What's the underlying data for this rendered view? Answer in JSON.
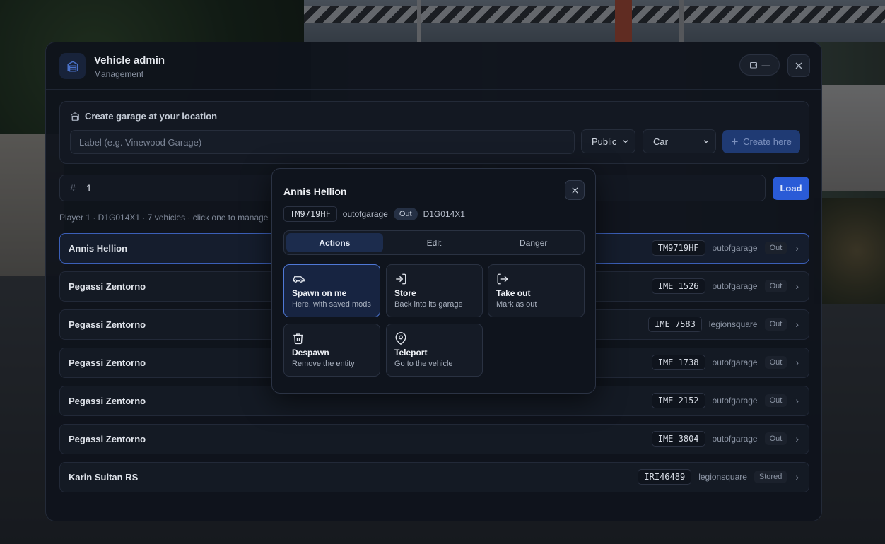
{
  "window": {
    "title": "Vehicle admin",
    "subtitle": "Management",
    "minimize_label": "—"
  },
  "garage_form": {
    "title": "Create garage at your location",
    "label_placeholder": "Label (e.g. Vinewood Garage)",
    "visibility": "Public",
    "type": "Car",
    "create_label": "Create here"
  },
  "search": {
    "prefix": "#",
    "value": "1",
    "load_label": "Load"
  },
  "player_line": "Player 1 · D1G014X1 · 7 vehicles · click one to manage it",
  "vehicles": [
    {
      "name": "Annis Hellion",
      "plate": "TM9719HF",
      "garage": "outofgarage",
      "status": "Out"
    },
    {
      "name": "Pegassi Zentorno",
      "plate": "IME 1526",
      "garage": "outofgarage",
      "status": "Out"
    },
    {
      "name": "Pegassi Zentorno",
      "plate": "IME 7583",
      "garage": "legionsquare",
      "status": "Out"
    },
    {
      "name": "Pegassi Zentorno",
      "plate": "IME 1738",
      "garage": "outofgarage",
      "status": "Out"
    },
    {
      "name": "Pegassi Zentorno",
      "plate": "IME 2152",
      "garage": "outofgarage",
      "status": "Out"
    },
    {
      "name": "Pegassi Zentorno",
      "plate": "IME 3804",
      "garage": "outofgarage",
      "status": "Out"
    },
    {
      "name": "Karin Sultan RS",
      "plate": "IRI46489",
      "garage": "legionsquare",
      "status": "Stored"
    }
  ],
  "modal": {
    "title": "Annis Hellion",
    "plate": "TM9719HF",
    "garage": "outofgarage",
    "status": "Out",
    "owner": "D1G014X1",
    "tabs": [
      "Actions",
      "Edit",
      "Danger"
    ],
    "active_tab": "Actions",
    "actions": [
      {
        "icon": "car-icon",
        "title": "Spawn on me",
        "subtitle": "Here, with saved mods"
      },
      {
        "icon": "log-in-icon",
        "title": "Store",
        "subtitle": "Back into its garage"
      },
      {
        "icon": "log-out-icon",
        "title": "Take out",
        "subtitle": "Mark as out"
      },
      {
        "icon": "trash-icon",
        "title": "Despawn",
        "subtitle": "Remove the entity"
      },
      {
        "icon": "map-pin-icon",
        "title": "Teleport",
        "subtitle": "Go to the vehicle"
      }
    ]
  },
  "colors": {
    "accent": "#2a5bd7",
    "panel": "#0f131c",
    "highlight_border": "#4f78d6"
  }
}
